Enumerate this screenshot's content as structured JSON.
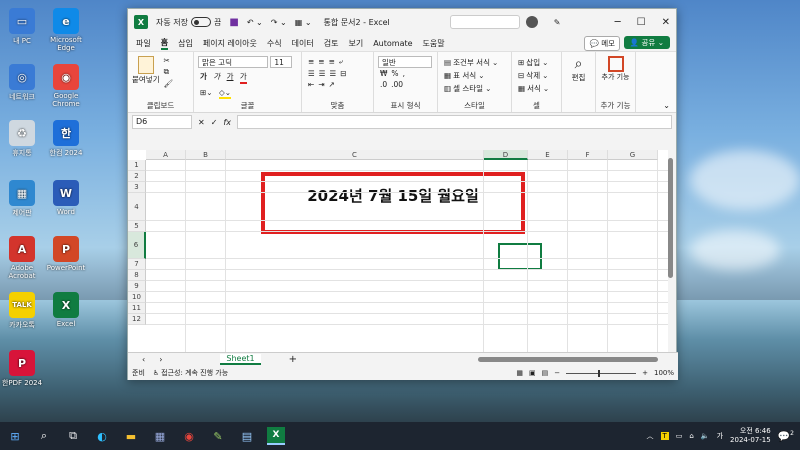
{
  "desktop": {
    "icons": [
      {
        "label": "내 PC",
        "color": "#3a7bd5",
        "glyph": "▭"
      },
      {
        "label": "Microsoft Edge",
        "color": "#0f8ae8",
        "glyph": "e"
      },
      {
        "label": "네트워크",
        "color": "#3a7bd5",
        "glyph": "◎"
      },
      {
        "label": "Google Chrome",
        "color": "#e8453c",
        "glyph": "◉"
      },
      {
        "label": "휴지통",
        "color": "#cfd8e0",
        "glyph": "♻"
      },
      {
        "label": "한컴 2024",
        "color": "#1e6fd9",
        "glyph": "한"
      },
      {
        "label": "제어판",
        "color": "#2f88d0",
        "glyph": "▦"
      },
      {
        "label": "Word",
        "color": "#2b5cb8",
        "glyph": "W"
      },
      {
        "label": "Adobe Acrobat",
        "color": "#d3342c",
        "glyph": "A"
      },
      {
        "label": "PowerPoint",
        "color": "#d24726",
        "glyph": "P"
      },
      {
        "label": "카카오톡",
        "color": "#f5d000",
        "glyph": "TALK"
      },
      {
        "label": "Excel",
        "color": "#107c41",
        "glyph": "X"
      },
      {
        "label": "한PDF 2024",
        "color": "#d8143a",
        "glyph": "P"
      }
    ]
  },
  "titlebar": {
    "autosave_label": "자동 저장",
    "toggle_label": "끔",
    "doc_title": "통합 문서2 - Excel",
    "minimize": "─",
    "maximize": "☐",
    "close": "✕"
  },
  "menu": {
    "tabs": [
      "파일",
      "홈",
      "삽입",
      "페이지 레이아웃",
      "수식",
      "데이터",
      "검토",
      "보기",
      "Automate",
      "도움말"
    ],
    "active": "홈",
    "memo": "메모",
    "share": "공유"
  },
  "ribbon": {
    "clipboard": {
      "paste": "붙여넣기",
      "label": "클립보드"
    },
    "font": {
      "name": "맑은 고딕",
      "size": "11",
      "label": "글꼴",
      "bold": "가",
      "italic": "가",
      "underline": "가",
      "color_a": "가"
    },
    "align": {
      "label": "맞춤"
    },
    "number": {
      "format": "일반",
      "label": "표시 형식"
    },
    "styles": {
      "cond": "조건부 서식",
      "table": "표 서식",
      "cell": "셀 스타일",
      "label": "스타일"
    },
    "cells": {
      "insert": "삽입",
      "delete": "삭제",
      "format": "서식",
      "label": "셀"
    },
    "editing": {
      "label": "편집"
    },
    "addins": {
      "add": "추가 기능",
      "label": "추가 기능"
    }
  },
  "formula_bar": {
    "name_box": "D6",
    "fx": "fx",
    "value": ""
  },
  "grid": {
    "columns": [
      "A",
      "B",
      "C",
      "D",
      "E",
      "F",
      "G"
    ],
    "rows": [
      "1",
      "2",
      "3",
      "4",
      "5",
      "6",
      "7",
      "8",
      "9",
      "10",
      "11",
      "12"
    ],
    "c4_text": "2024년 7월 15일 월요일",
    "active_cell": "D6"
  },
  "sheets": {
    "tabs": [
      "Sheet1"
    ],
    "add": "+"
  },
  "status": {
    "ready": "준비",
    "accessibility": "접근성: 계속 진행 가능",
    "zoom": "100%"
  },
  "taskbar": {
    "time": "오전 6:46",
    "date": "2024-07-15",
    "ime": "가",
    "notif_count": "2"
  }
}
